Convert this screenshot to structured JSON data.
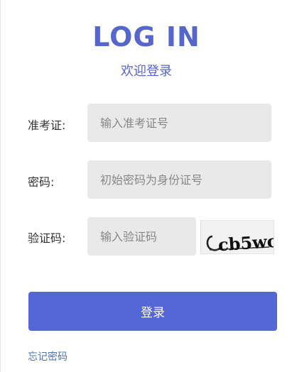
{
  "header": {
    "title": "LOG IN",
    "subtitle": "欢迎登录"
  },
  "form": {
    "exam_id_label": "准考证:",
    "exam_id_placeholder": "输入准考证号",
    "password_label": "密码:",
    "password_placeholder": "初始密码为身份证号",
    "captcha_label": "验证码:",
    "captcha_placeholder": "输入验证码",
    "captcha_text": "cb5wc",
    "login_button": "登录",
    "forgot_link": "忘记密码"
  },
  "colors": {
    "accent": "#5566d6",
    "title": "#5566cc",
    "field_bg": "#e9e9e9",
    "link": "#4a72b8"
  }
}
